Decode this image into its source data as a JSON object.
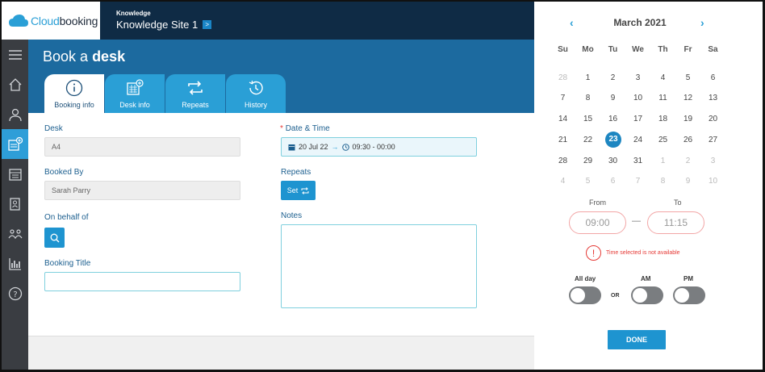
{
  "app": {
    "logo_text_a": "Cloud",
    "logo_text_b": "booking",
    "site_label": "Knowledge",
    "site_name": "Knowledge Site 1",
    "site_arrow": ">"
  },
  "nav": {
    "items": [
      "menu-icon",
      "home-icon",
      "user-icon",
      "desk-booking-icon",
      "calendar-icon",
      "visitor-icon",
      "people-icon",
      "reports-icon",
      "help-icon"
    ],
    "active_index": 3
  },
  "header": {
    "title_prefix": "Book a",
    "title_bold": "desk",
    "tabs": [
      {
        "label": "Booking info",
        "icon": "info-icon"
      },
      {
        "label": "Desk info",
        "icon": "desk-info-icon"
      },
      {
        "label": "Repeats",
        "icon": "repeat-icon"
      },
      {
        "label": "History",
        "icon": "history-icon"
      }
    ]
  },
  "form": {
    "desk_label": "Desk",
    "desk_value": "A4",
    "booked_by_label": "Booked By",
    "booked_by_value": "Sarah Parry",
    "on_behalf_label": "On behalf of",
    "booking_title_label": "Booking Title",
    "booking_title_value": "",
    "datetime_required": "*",
    "datetime_label": "Date & Time",
    "date_value": "20 Jul 22",
    "arrow": "→",
    "time_value": "09:30 - 00:00",
    "repeats_label": "Repeats",
    "set_label": "Set",
    "notes_label": "Notes"
  },
  "calendar": {
    "prev": "‹",
    "next": "›",
    "month": "March 2021",
    "days_of_week": [
      "Su",
      "Mo",
      "Tu",
      "We",
      "Th",
      "Fr",
      "Sa"
    ],
    "weeks": [
      [
        "28",
        "1",
        "2",
        "3",
        "4",
        "5",
        "6"
      ],
      [
        "7",
        "8",
        "9",
        "10",
        "11",
        "12",
        "13"
      ],
      [
        "14",
        "15",
        "16",
        "17",
        "18",
        "19",
        "20"
      ],
      [
        "21",
        "22",
        "23",
        "24",
        "25",
        "26",
        "27"
      ],
      [
        "28",
        "29",
        "30",
        "31",
        "1",
        "2",
        "3"
      ],
      [
        "4",
        "5",
        "6",
        "7",
        "8",
        "9",
        "10"
      ]
    ],
    "selected_day": "23",
    "from_label": "From",
    "to_label": "To",
    "from_value": "09:00",
    "to_value": "11:15",
    "dash": "—",
    "error_icon": "!",
    "error_text": "Time selected is not available",
    "all_day_label": "All day",
    "or_label": "OR",
    "am_label": "AM",
    "pm_label": "PM",
    "done_label": "DONE"
  },
  "colors": {
    "brand_dark": "#0f2b45",
    "header_blue": "#1c6a9f",
    "accent": "#2a9fd6",
    "error": "#e53935"
  }
}
